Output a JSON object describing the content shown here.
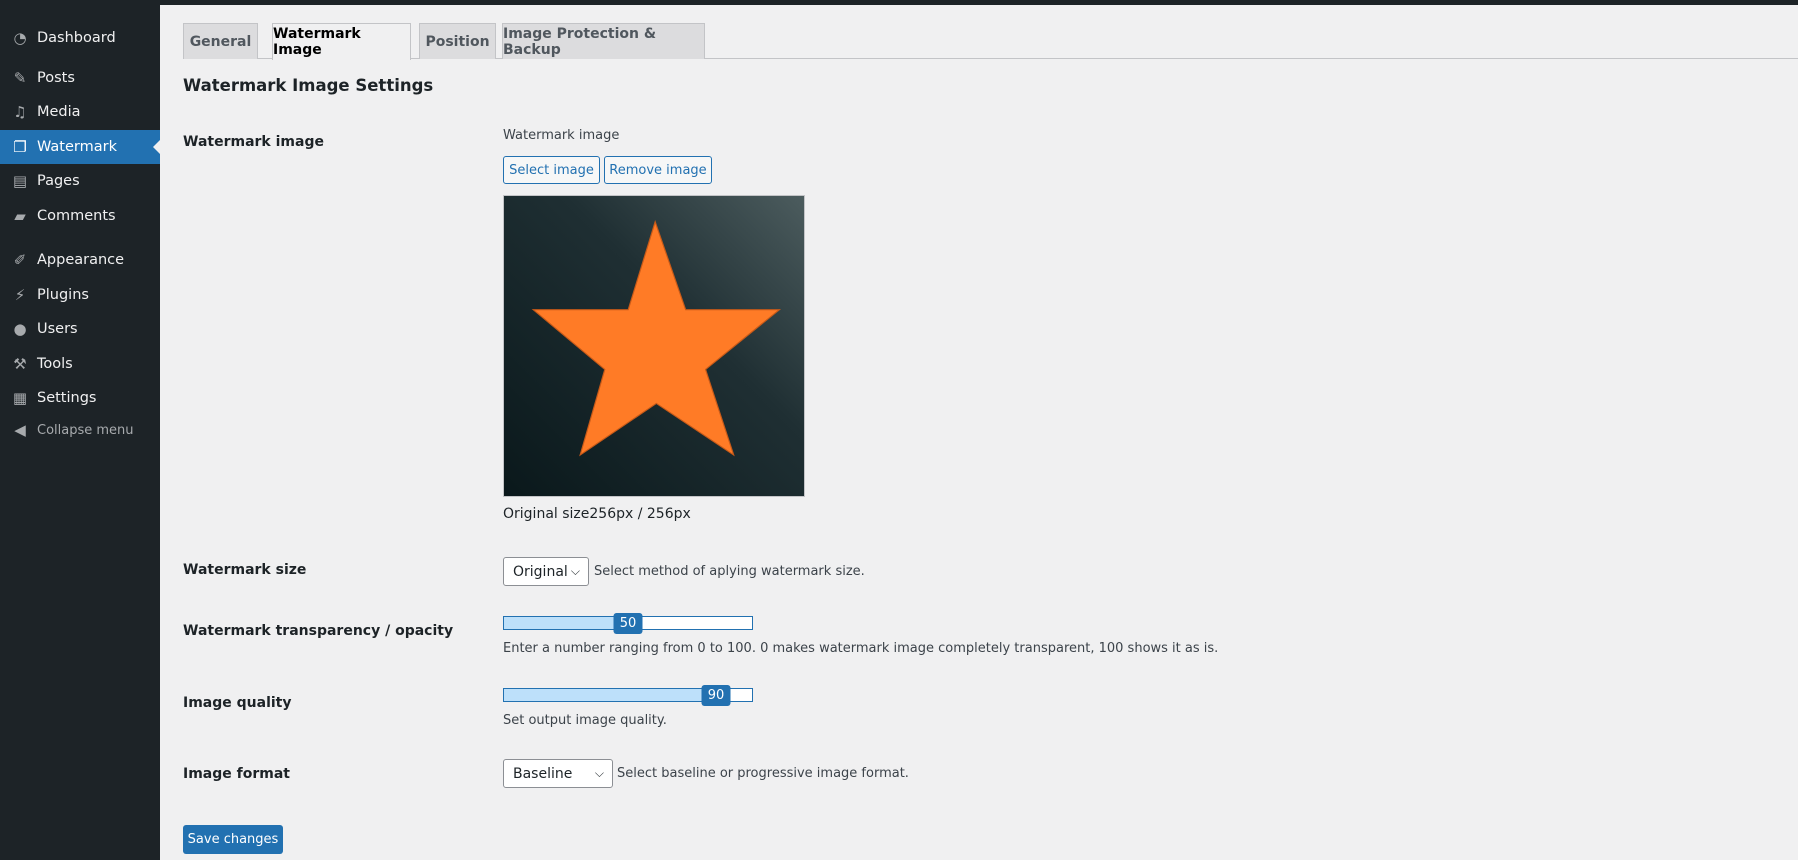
{
  "sidebar": {
    "items": [
      {
        "label": "Dashboard",
        "icon": "dashboard-icon"
      },
      {
        "label": "Posts",
        "icon": "pin-icon"
      },
      {
        "label": "Media",
        "icon": "media-icon"
      },
      {
        "label": "Watermark",
        "icon": "watermark-icon",
        "active": true
      },
      {
        "label": "Pages",
        "icon": "pages-icon"
      },
      {
        "label": "Comments",
        "icon": "comment-icon"
      },
      {
        "label": "Appearance",
        "icon": "brush-icon"
      },
      {
        "label": "Plugins",
        "icon": "plug-icon"
      },
      {
        "label": "Users",
        "icon": "user-icon"
      },
      {
        "label": "Tools",
        "icon": "wrench-icon"
      },
      {
        "label": "Settings",
        "icon": "settings-icon"
      },
      {
        "label": "Collapse menu",
        "icon": "collapse-icon"
      }
    ]
  },
  "tabs": [
    {
      "label": "General"
    },
    {
      "label": "Watermark Image",
      "active": true
    },
    {
      "label": "Position"
    },
    {
      "label": "Image Protection & Backup"
    }
  ],
  "main": {
    "heading": "Watermark Image Settings",
    "watermark_image": {
      "label": "Watermark image",
      "sublabel": "Watermark image",
      "select_button": "Select image",
      "remove_button": "Remove image",
      "original_size": "Original size256px / 256px"
    },
    "watermark_size": {
      "label": "Watermark size",
      "value": "Original",
      "help": "Select method of aplying watermark size."
    },
    "transparency": {
      "label": "Watermark transparency / opacity",
      "value": "50",
      "min": 0,
      "max": 100,
      "help": "Enter a number ranging from 0 to 100. 0 makes watermark image completely transparent, 100 shows it as is."
    },
    "quality": {
      "label": "Image quality",
      "value": "90",
      "min": 0,
      "max": 100,
      "help": "Set output image quality."
    },
    "format": {
      "label": "Image format",
      "value": "Baseline",
      "help": "Select baseline or progressive image format."
    },
    "save_label": "Save changes"
  },
  "colors": {
    "accent": "#2271b1",
    "sidebar": "#1d2327",
    "star": "#ff7b26",
    "slider_fill": "#bde0fa"
  }
}
